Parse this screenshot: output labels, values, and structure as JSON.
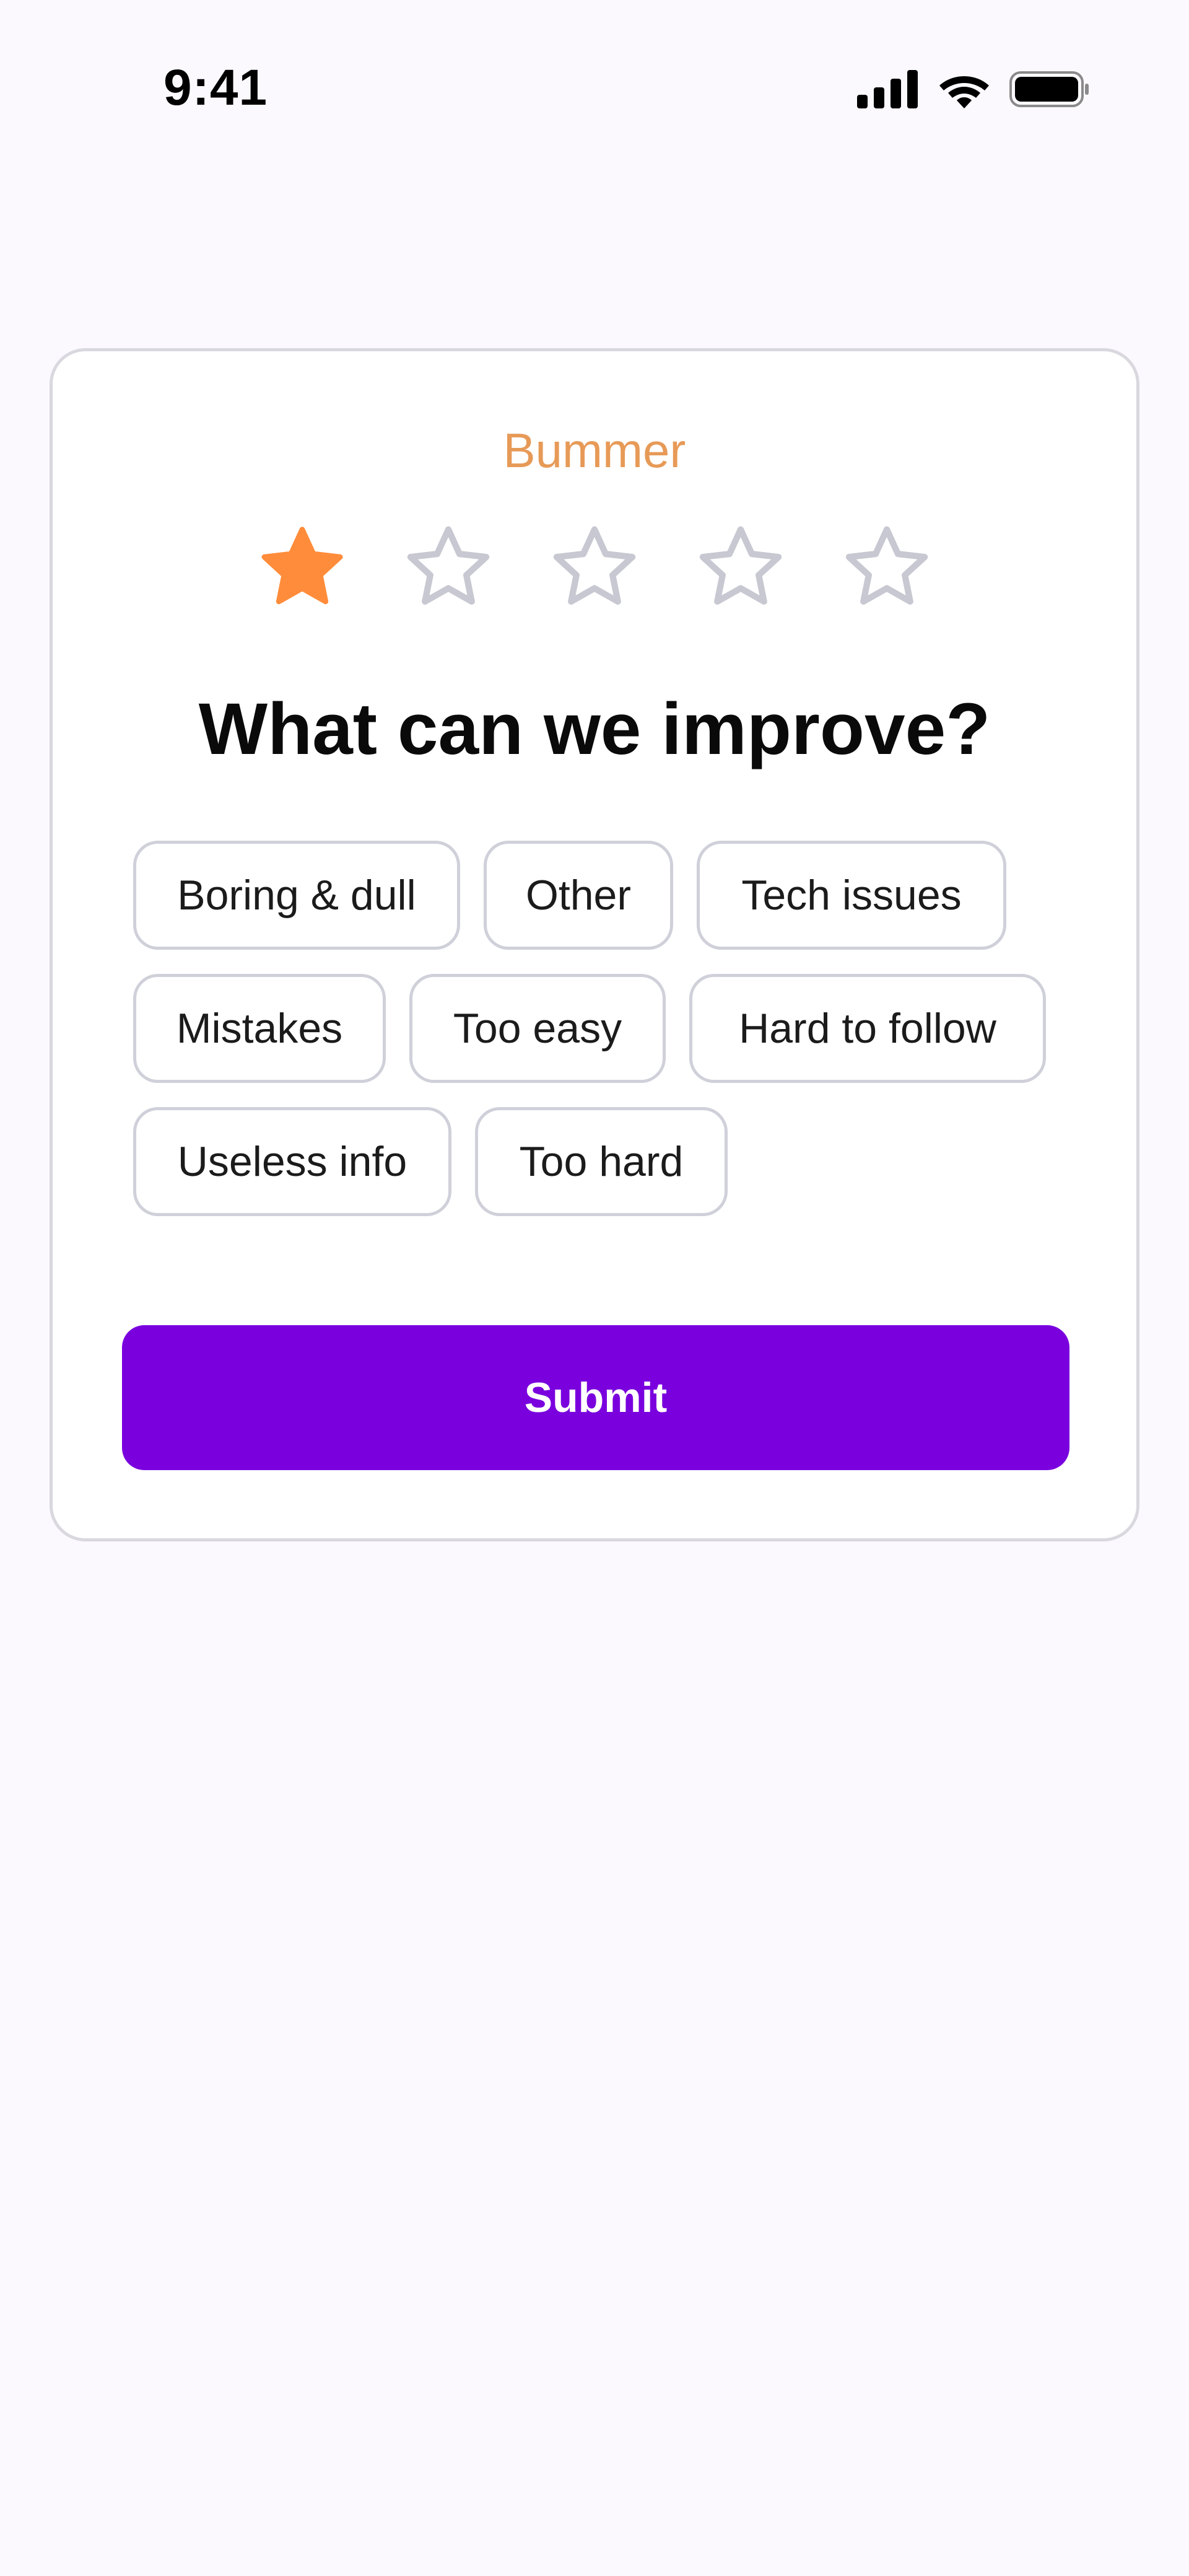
{
  "status_bar": {
    "time": "9:41"
  },
  "feedback": {
    "mood_label": "Bummer",
    "rating": 1,
    "rating_max": 5,
    "question": "What can we improve?",
    "chips": [
      "Boring & dull",
      "Other",
      "Tech issues",
      "Mistakes",
      "Too easy",
      "Hard to follow",
      "Useless info",
      "Too hard"
    ],
    "submit_label": "Submit"
  },
  "colors": {
    "star_filled": "#ff8c3a",
    "star_empty": "#c7c8d1",
    "mood_text": "#e79a57",
    "submit_bg": "#7a00de",
    "page_bg": "#fbf9fe"
  },
  "icons": {
    "signal": "cellular-signal-icon",
    "wifi": "wifi-icon",
    "battery": "battery-icon",
    "star": "star-icon"
  }
}
